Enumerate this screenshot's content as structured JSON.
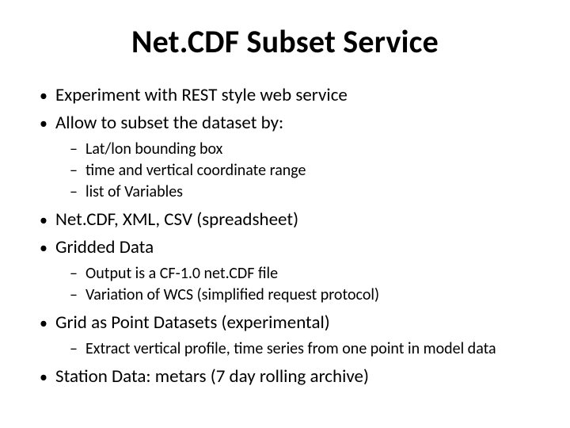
{
  "title": "Net.CDF Subset Service",
  "bullets": {
    "b1": "Experiment with REST style web service",
    "b2": "Allow to subset the dataset by:",
    "b2_sub": {
      "s1": "Lat/lon bounding box",
      "s2": "time and vertical coordinate range",
      "s3": "list of Variables"
    },
    "b3": "Net.CDF, XML, CSV (spreadsheet)",
    "b4": "Gridded Data",
    "b4_sub": {
      "s1": "Output is a CF-1.0 net.CDF file",
      "s2": "Variation of WCS (simplified request protocol)"
    },
    "b5": "Grid as Point Datasets (experimental)",
    "b5_sub": {
      "s1": "Extract vertical profile, time series from one point in model data"
    },
    "b6": "Station Data: metars (7 day rolling archive)"
  }
}
